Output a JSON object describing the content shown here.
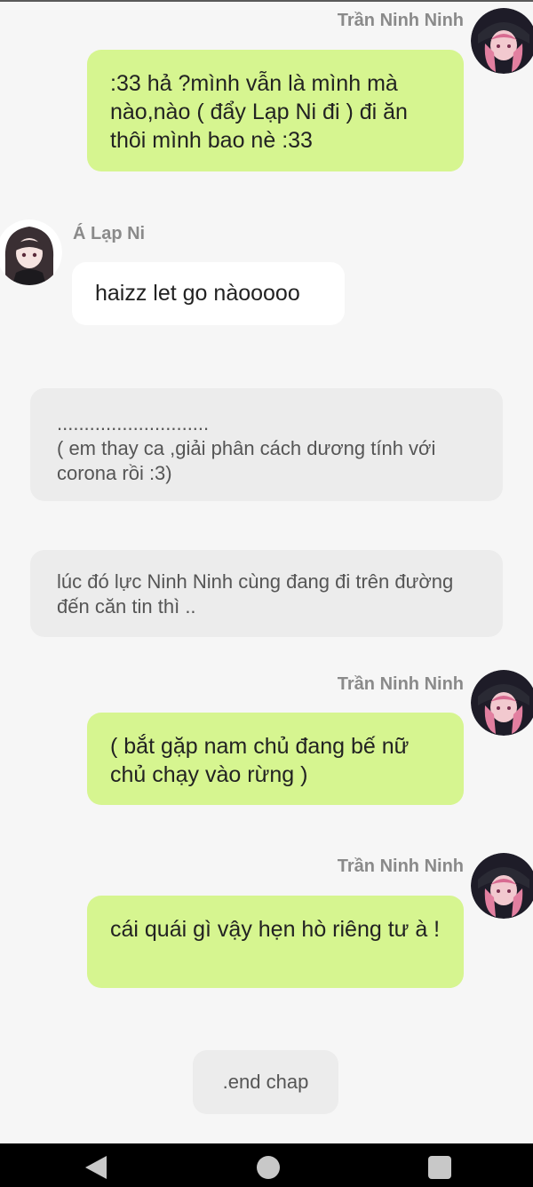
{
  "characters": {
    "ninh": {
      "name": "Trần Ninh Ninh"
    },
    "lapni": {
      "name": "Á Lạp Ni"
    }
  },
  "messages": [
    {
      "speaker": "Trần Ninh Ninh",
      "text": ":33 hả ?mình vẫn là mình mà nào,nào ( đẩy Lạp Ni đi ) đi ăn thôi mình bao nè :33"
    },
    {
      "speaker": "Á Lạp Ni",
      "text": "haizz let go nàooooo"
    },
    {
      "narration": "............................\n( em thay ca ,giải phân cách dương tính với corona rồi :3)"
    },
    {
      "narration": "lúc đó lực Ninh Ninh cùng đang đi trên đường đến căn tin thì .."
    },
    {
      "speaker": "Trần Ninh Ninh",
      "text": "( bắt gặp nam chủ  đang bế nữ chủ chạy vào rừng )"
    },
    {
      "speaker": "Trần Ninh Ninh",
      "text": "cái quái gì vậy hẹn hò riêng tư à !"
    },
    {
      "chip": ".end chap"
    }
  ],
  "colors": {
    "background": "#f6f6f6",
    "right_bubble": "#d6f590",
    "left_bubble": "#ffffff",
    "narration_bubble": "#ececec",
    "navbar": "#000000"
  },
  "icons": {
    "nav_back": "back-triangle-icon",
    "nav_home": "home-circle-icon",
    "nav_recent": "recent-square-icon"
  }
}
